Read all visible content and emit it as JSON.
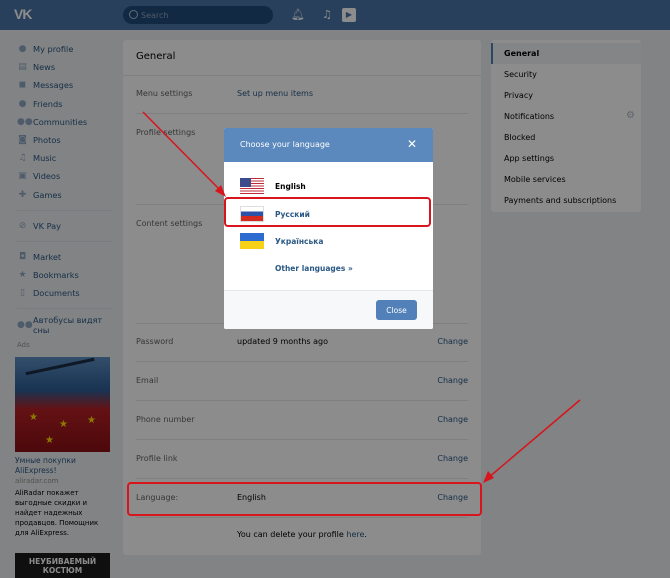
{
  "header": {
    "logo": "VK",
    "search_placeholder": "Search",
    "icons": [
      "bell-icon",
      "music-icon",
      "play-icon"
    ]
  },
  "leftnav": {
    "items": [
      {
        "label": "My profile",
        "icon": "person-icon"
      },
      {
        "label": "News",
        "icon": "news-icon"
      },
      {
        "label": "Messages",
        "icon": "chat-icon"
      },
      {
        "label": "Friends",
        "icon": "person-icon"
      },
      {
        "label": "Communities",
        "icon": "group-icon"
      },
      {
        "label": "Photos",
        "icon": "camera-icon"
      },
      {
        "label": "Music",
        "icon": "music-icon"
      },
      {
        "label": "Videos",
        "icon": "video-icon"
      },
      {
        "label": "Games",
        "icon": "gamepad-icon"
      }
    ],
    "pay": {
      "label": "VK Pay",
      "icon": "pay-icon"
    },
    "extra": [
      {
        "label": "Market",
        "icon": "bag-icon"
      },
      {
        "label": "Bookmarks",
        "icon": "star-icon"
      },
      {
        "label": "Documents",
        "icon": "doc-icon"
      }
    ],
    "community": {
      "label": "Автобусы видят сны",
      "icon": "group-icon"
    }
  },
  "ads": {
    "label": "Ads",
    "ad1": {
      "title": "Умные покупки AliExpress!",
      "domain": "aliradar.com",
      "text": "AliRadar покажет выгодные скидки и найдет надежных продавцов. Помощник для AliExpress."
    },
    "ad2": {
      "banner": "НЕУБИВАЕМЫЙ КОСТЮМ"
    }
  },
  "main": {
    "title": "General",
    "rows": [
      {
        "label": "Menu settings",
        "value": "Set up menu items",
        "change": ""
      },
      {
        "label": "Profile settings",
        "value": "",
        "change": ""
      },
      {
        "label": "Content settings",
        "value": "",
        "change": ""
      },
      {
        "label": "Password",
        "value": "updated 9 months ago",
        "change": "Change"
      },
      {
        "label": "Email",
        "value": "",
        "change": "Change"
      },
      {
        "label": "Phone number",
        "value": "",
        "change": "Change"
      },
      {
        "label": "Profile link",
        "value": "",
        "change": "Change"
      },
      {
        "label": "Language:",
        "value": "English",
        "change": "Change"
      }
    ],
    "delete_text": "You can delete your profile ",
    "delete_link": "here",
    "delete_end": "."
  },
  "rightnav": {
    "items": [
      "General",
      "Security",
      "Privacy",
      "Notifications",
      "Blocked",
      "App settings",
      "Mobile services"
    ],
    "payments": "Payments and subscriptions"
  },
  "dialog": {
    "title": "Choose your language",
    "languages": [
      {
        "name": "English",
        "flag": "us-flag-icon"
      },
      {
        "name": "Русский",
        "flag": "ru-flag-icon"
      },
      {
        "name": "Українська",
        "flag": "ua-flag-icon"
      }
    ],
    "other": "Other languages »",
    "close_button": "Close"
  },
  "colors": {
    "header": "#4a76a8",
    "link": "#2a5885",
    "accent": "#5181b8",
    "annotation": "#d8141c"
  }
}
